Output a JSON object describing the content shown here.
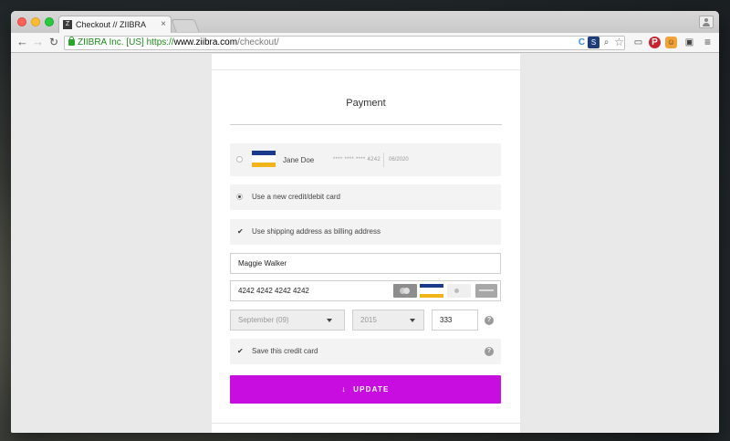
{
  "browser": {
    "tab_title": "Checkout // ZIIBRA",
    "tab_favicon": "Z",
    "tab_close": "×",
    "ev_label": "ZIIBRA Inc. [US]",
    "url_scheme": "https://",
    "url_host": "www.ziibra.com",
    "url_path": "/checkout/",
    "nav": {
      "back": "←",
      "forward": "→",
      "reload": "↻"
    },
    "extensions": {
      "ext1": "C",
      "ext2": "S",
      "search": "⌕",
      "star": "☆",
      "cast": "▭",
      "pinterest": "P",
      "monkey": "☺",
      "screen": "▣",
      "menu": "≡"
    }
  },
  "payment": {
    "title": "Payment",
    "saved_card": {
      "name": "Jane Doe",
      "number": "**** **** **** 4242",
      "expiry": "06/2020"
    },
    "new_card_option": "Use a new credit/debit card",
    "shipping_as_billing": "Use shipping address as billing address",
    "check_glyph": "✔",
    "cardholder_name": "Maggie Walker",
    "card_number": "4242 4242 4242 4242",
    "expiry_month": "September (09)",
    "expiry_year": "2015",
    "cvv": "333",
    "help_glyph": "?",
    "save_card_label": "Save this credit card",
    "update_arrow": "↓",
    "update_label": "UPDATE"
  },
  "colors": {
    "accent": "#c80de0",
    "visa_blue": "#1b3a8c",
    "visa_gold": "#f2b41b"
  }
}
